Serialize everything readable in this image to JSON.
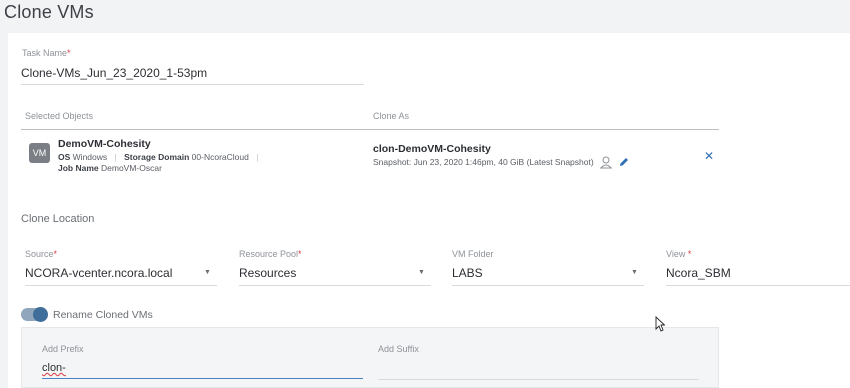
{
  "page": {
    "title": "Clone VMs"
  },
  "task": {
    "label": "Task Name",
    "required": "*",
    "value": "Clone-VMs_Jun_23_2020_1-53pm"
  },
  "objects": {
    "col_selected": "Selected Objects",
    "col_clone_as": "Clone As",
    "vm": {
      "badge": "VM",
      "name": "DemoVM-Cohesity",
      "os_label": "OS",
      "os_value": "Windows",
      "storage_label": "Storage Domain",
      "storage_value": "00-NcoraCloud",
      "job_label": "Job Name",
      "job_value": "DemoVM-Oscar",
      "clone_name": "clon-DemoVM-Cohesity",
      "snapshot": "Snapshot: Jun 23, 2020 1:46pm, 40 GiB (Latest Snapshot)"
    }
  },
  "location": {
    "heading": "Clone Location",
    "source_label": "Source",
    "source_value": "NCORA-vcenter.ncora.local",
    "pool_label": "Resource Pool",
    "pool_value": "Resources",
    "folder_label": "VM Folder",
    "folder_value": "LABS",
    "view_label": "View",
    "view_value": "Ncora_SBM",
    "required": "*"
  },
  "rename": {
    "toggle_label": "Rename Cloned VMs",
    "toggle_on": true,
    "prefix_label": "Add Prefix",
    "prefix_value": "clon-",
    "suffix_label": "Add Suffix",
    "suffix_value": ""
  },
  "colors": {
    "accent": "#2f6fb3",
    "required": "#d9363e"
  },
  "icons": [
    "user-recovery-icon",
    "pencil-edit-icon",
    "close-icon",
    "chevron-down-icon",
    "mouse-cursor-icon"
  ]
}
